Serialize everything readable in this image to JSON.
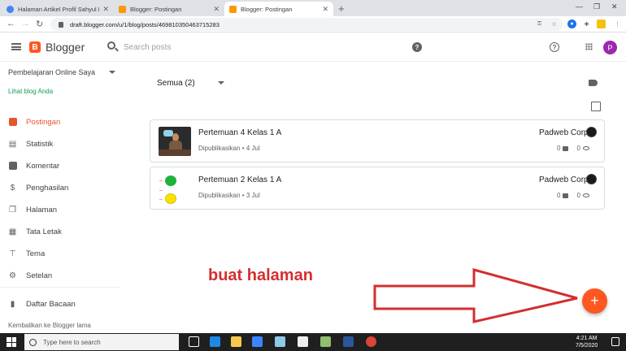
{
  "browser": {
    "tabs": [
      {
        "title": "Halaman Artikel Profil Sahyul Pa",
        "active": false
      },
      {
        "title": "Blogger: Postingan",
        "active": false
      },
      {
        "title": "Blogger: Postingan",
        "active": true
      }
    ],
    "url": "draft.blogger.com/u/1/blog/posts/4698103504637152­83"
  },
  "header": {
    "brand": "Blogger",
    "search_placeholder": "Search posts",
    "help_icon": "help-icon",
    "avatar_letter": "P"
  },
  "sidebar": {
    "blog_name": "Pembelajaran Online Saya",
    "view_blog": "Lihat blog Anda",
    "items": [
      {
        "label": "Postingan",
        "icon": "posts-icon",
        "active": true
      },
      {
        "label": "Statistik",
        "icon": "stats-icon"
      },
      {
        "label": "Komentar",
        "icon": "comment-icon"
      },
      {
        "label": "Penghasilan",
        "icon": "dollar-icon"
      },
      {
        "label": "Halaman",
        "icon": "pages-icon"
      },
      {
        "label": "Tata Letak",
        "icon": "layout-icon"
      },
      {
        "label": "Tema",
        "icon": "paint-roller-icon"
      },
      {
        "label": "Setelan",
        "icon": "gear-icon"
      }
    ],
    "reading_list": "Daftar Bacaan",
    "legacy": "Kembalikan ke Blogger lama"
  },
  "main": {
    "filter": "Semua (2)",
    "posts": [
      {
        "title": "Pertemuan 4 Kelas 1 A",
        "meta": "Dipublikasikan • 4 Jul",
        "author": "Padweb Corp",
        "comments": "0",
        "views": "0"
      },
      {
        "title": "Pertemuan 2 Kelas 1 A",
        "meta": "Dipublikasikan • 3 Jul",
        "author": "Padweb Corp",
        "comments": "0",
        "views": "0"
      }
    ],
    "annotation": "buat halaman",
    "fab": "+"
  },
  "taskbar": {
    "search_placeholder": "Type here to search",
    "time": "4:21 AM",
    "date": "7/5/2020"
  },
  "colors": {
    "accent": "#ff5722",
    "active_nav": "#e8542c",
    "link": "#0f9d58",
    "annotation": "#d32f2f"
  }
}
